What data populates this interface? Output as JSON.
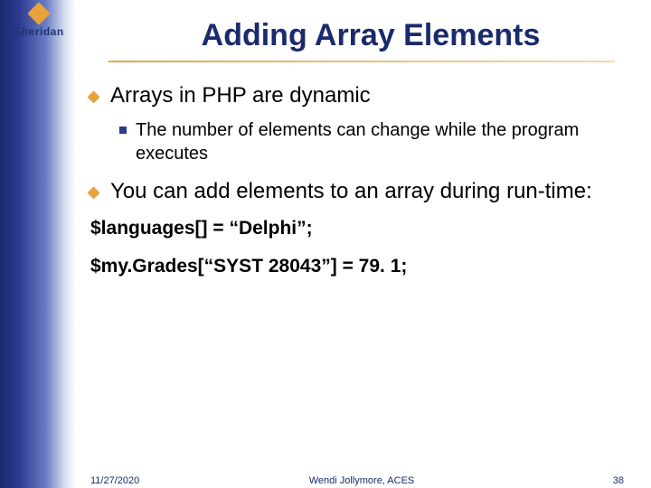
{
  "logo": {
    "text": "Sheridan"
  },
  "title": "Adding Array Elements",
  "bullets": [
    {
      "level": 1,
      "text": "Arrays in PHP are dynamic"
    },
    {
      "level": 2,
      "text": "The number of elements can change while the program executes"
    },
    {
      "level": 1,
      "text": "You can add elements to an array during run-time:"
    }
  ],
  "code": [
    "$languages[] = “Delphi”;",
    "$my.Grades[“SYST 28043”] = 79. 1;"
  ],
  "footer": {
    "date": "11/27/2020",
    "center": "Wendi Jollymore, ACES",
    "page": "38"
  }
}
